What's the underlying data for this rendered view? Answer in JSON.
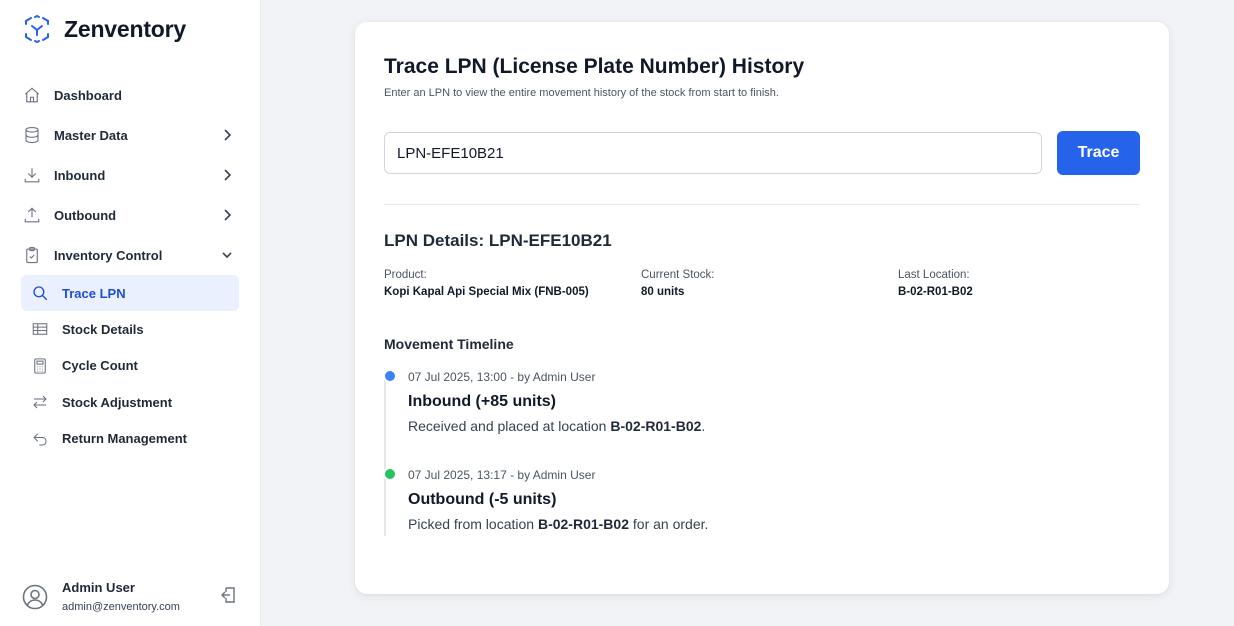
{
  "app": {
    "name": "Zenventory"
  },
  "sidebar": {
    "nav": [
      {
        "label": "Dashboard",
        "icon": "home-icon"
      },
      {
        "label": "Master Data",
        "icon": "database-icon",
        "expandable": true
      },
      {
        "label": "Inbound",
        "icon": "download-icon",
        "expandable": true
      },
      {
        "label": "Outbound",
        "icon": "upload-icon",
        "expandable": true
      },
      {
        "label": "Inventory Control",
        "icon": "clipboard-check-icon",
        "expanded": true
      }
    ],
    "sub": [
      {
        "label": "Trace LPN",
        "icon": "search-icon",
        "active": true
      },
      {
        "label": "Stock Details",
        "icon": "table-icon"
      },
      {
        "label": "Cycle Count",
        "icon": "calculator-icon"
      },
      {
        "label": "Stock Adjustment",
        "icon": "swap-arrows-icon"
      },
      {
        "label": "Return Management",
        "icon": "return-arrow-icon"
      }
    ],
    "user": {
      "name": "Admin User",
      "email": "admin@zenventory.com"
    }
  },
  "main": {
    "title": "Trace LPN (License Plate Number) History",
    "subtitle": "Enter an LPN to view the entire movement history of the stock from start to finish.",
    "lpn_input": "LPN-EFE10B21",
    "trace_label": "Trace",
    "details": {
      "title": "LPN Details: LPN-EFE10B21",
      "product_label": "Product:",
      "product_value": "Kopi Kapal Api Special Mix (FNB-005)",
      "stock_label": "Current Stock:",
      "stock_value": "80 units",
      "location_label": "Last Location:",
      "location_value": "B-02-R01-B02"
    },
    "timeline": {
      "title": "Movement Timeline",
      "events": [
        {
          "meta": "07 Jul 2025, 13:00 - by Admin User",
          "heading": "Inbound (+85 units)",
          "desc_prefix": "Received and placed at location ",
          "desc_location": "B-02-R01-B02",
          "desc_suffix": ".",
          "color": "#3b82f6"
        },
        {
          "meta": "07 Jul 2025, 13:17 - by Admin User",
          "heading": "Outbound (-5 units)",
          "desc_prefix": "Picked from location ",
          "desc_location": "B-02-R01-B02",
          "desc_suffix": " for an order.",
          "color": "#22c55e"
        }
      ]
    }
  },
  "colors": {
    "accent": "#2563eb",
    "inbound_dot": "#3b82f6",
    "outbound_dot": "#22c55e"
  }
}
